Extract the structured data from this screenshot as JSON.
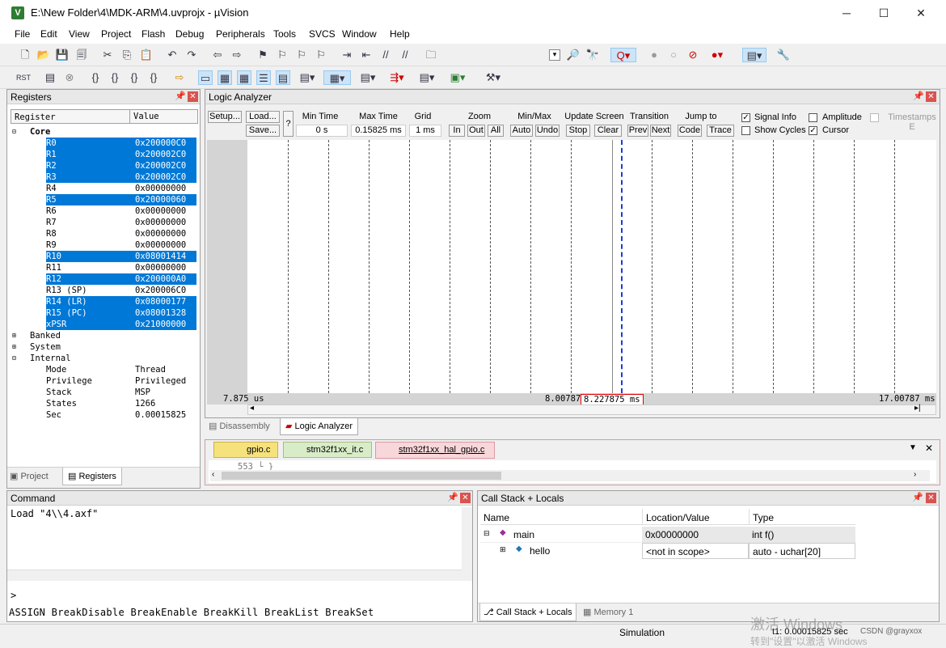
{
  "window": {
    "title": "E:\\New Folder\\4\\MDK-ARM\\4.uvprojx - µVision",
    "minimize": "─",
    "maximize": "☐",
    "close": "✕"
  },
  "menu": [
    "File",
    "Edit",
    "View",
    "Project",
    "Flash",
    "Debug",
    "Peripherals",
    "Tools",
    "SVCS",
    "Window",
    "Help"
  ],
  "registers": {
    "title": "Registers",
    "col_register": "Register",
    "col_value": "Value",
    "core_label": "Core",
    "rows": [
      {
        "name": "R0",
        "value": "0x200000C0",
        "sel": true
      },
      {
        "name": "R1",
        "value": "0x200002C0",
        "sel": true
      },
      {
        "name": "R2",
        "value": "0x200002C0",
        "sel": true
      },
      {
        "name": "R3",
        "value": "0x200002C0",
        "sel": true
      },
      {
        "name": "R4",
        "value": "0x00000000",
        "sel": false
      },
      {
        "name": "R5",
        "value": "0x20000060",
        "sel": true
      },
      {
        "name": "R6",
        "value": "0x00000000",
        "sel": false
      },
      {
        "name": "R7",
        "value": "0x00000000",
        "sel": false
      },
      {
        "name": "R8",
        "value": "0x00000000",
        "sel": false
      },
      {
        "name": "R9",
        "value": "0x00000000",
        "sel": false
      },
      {
        "name": "R10",
        "value": "0x08001414",
        "sel": true
      },
      {
        "name": "R11",
        "value": "0x00000000",
        "sel": false
      },
      {
        "name": "R12",
        "value": "0x200000A0",
        "sel": true
      },
      {
        "name": "R13 (SP)",
        "value": "0x200006C0",
        "sel": false
      },
      {
        "name": "R14 (LR)",
        "value": "0x08000177",
        "sel": true
      },
      {
        "name": "R15 (PC)",
        "value": "0x08001328",
        "sel": true
      },
      {
        "name": "xPSR",
        "value": "0x21000000",
        "sel": true
      }
    ],
    "groups": [
      "Banked",
      "System",
      "Internal"
    ],
    "internal": [
      {
        "name": "Mode",
        "value": "Thread"
      },
      {
        "name": "Privilege",
        "value": "Privileged"
      },
      {
        "name": "Stack",
        "value": "MSP"
      },
      {
        "name": "States",
        "value": "1266"
      },
      {
        "name": "Sec",
        "value": "0.00015825"
      }
    ],
    "tab_project": "Project",
    "tab_registers": "Registers"
  },
  "logic": {
    "title": "Logic Analyzer",
    "setup": "Setup...",
    "load": "Load...",
    "save": "Save...",
    "help": "?",
    "min_time_label": "Min Time",
    "min_time": "0 s",
    "max_time_label": "Max Time",
    "max_time": "0.15825 ms",
    "grid_label": "Grid",
    "grid": "1 ms",
    "zoom_label": "Zoom",
    "zoom_in": "In",
    "zoom_out": "Out",
    "zoom_all": "All",
    "minmax_label": "Min/Max",
    "auto": "Auto",
    "undo": "Undo",
    "update_label": "Update Screen",
    "stop": "Stop",
    "clear": "Clear",
    "transition_label": "Transition",
    "prev": "Prev",
    "next": "Next",
    "jump_label": "Jump to",
    "code": "Code",
    "trace": "Trace",
    "signal_info": "Signal Info",
    "show_cycles": "Show Cycles",
    "amplitude": "Amplitude",
    "cursor": "Cursor",
    "timestamps": "Timestamps E",
    "t_left": "7.875 us",
    "t_mid": "8.00787",
    "t_cursor": "8.227875 ms",
    "t_right": "17.00787 ms",
    "tab_disassembly": "Disassembly",
    "tab_logic": "Logic Analyzer"
  },
  "editor": {
    "tabs": [
      "gpio.c",
      "stm32f1xx_it.c",
      "stm32f1xx_hal_gpio.c"
    ],
    "line": "553  └  }"
  },
  "command": {
    "title": "Command",
    "output": "Load \"4\\\\4.axf\"",
    "prompt": ">",
    "hints": "ASSIGN BreakDisable BreakEnable BreakKill BreakList BreakSet"
  },
  "callstack": {
    "title": "Call Stack + Locals",
    "col_name": "Name",
    "col_loc": "Location/Value",
    "col_type": "Type",
    "rows": [
      {
        "name": "main",
        "loc": "0x00000000",
        "type": "int f()"
      },
      {
        "name": "hello",
        "loc": "<not in scope>",
        "type": "auto - uchar[20]"
      }
    ],
    "tab_callstack": "Call Stack + Locals",
    "tab_memory": "Memory 1"
  },
  "status": {
    "mode": "Simulation",
    "time": "t1: 0.00015825 sec",
    "watermark": "激活 Windows",
    "watermark2": "转到\"设置\"以激活 Windows",
    "credit": "CSDN @grayxox"
  },
  "colors": {
    "selection": "#0078d7",
    "accent": "#cce4f7",
    "close": "#d9534f"
  }
}
